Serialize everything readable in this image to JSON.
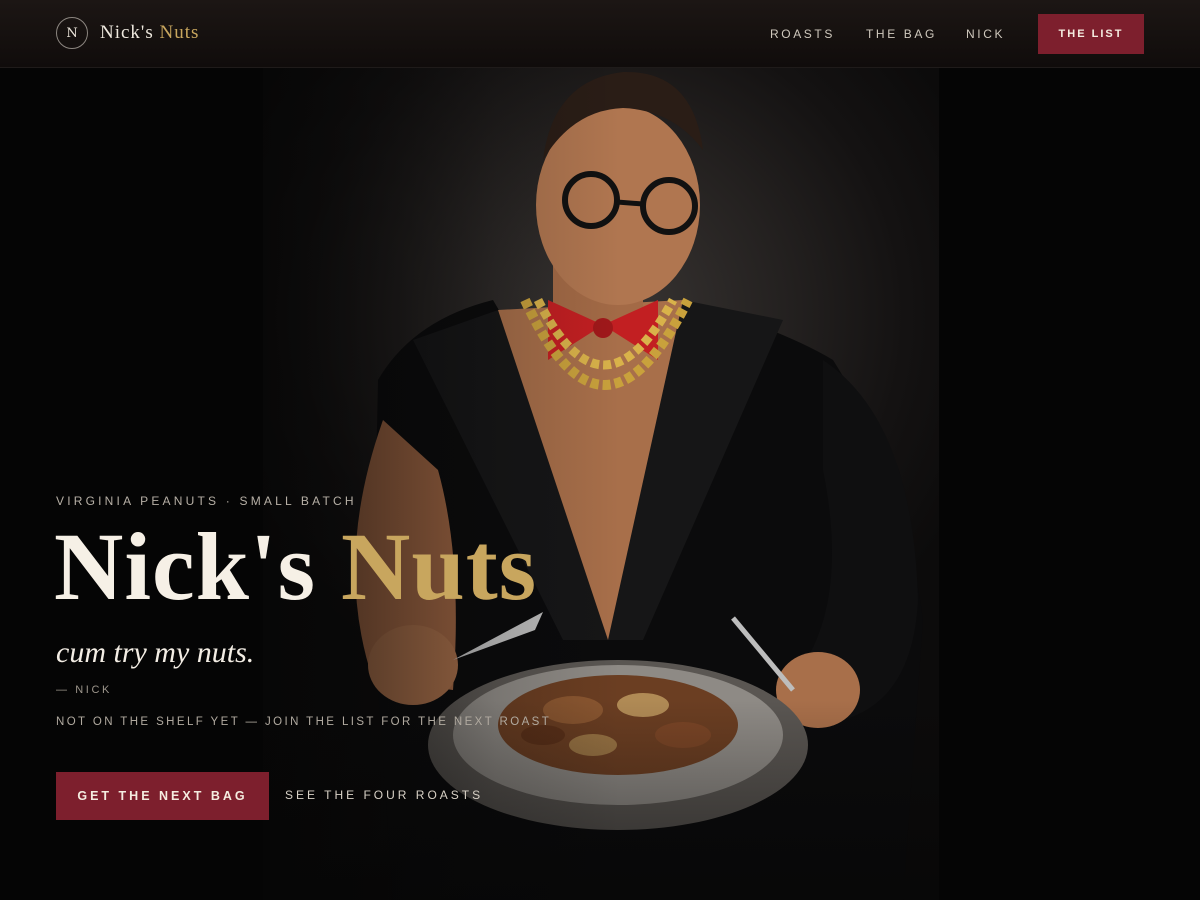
{
  "header": {
    "logo_mark": "N",
    "logo_name_part1": "Nick's",
    "logo_name_part2": "Nuts",
    "nav": {
      "roasts": "ROASTS",
      "the_bag": "THE BAG",
      "nick": "NICK"
    },
    "cta_label": "THE LIST"
  },
  "hero": {
    "eyebrow": "VIRGINIA PEANUTS · SMALL BATCH",
    "title_part1": "Nick's",
    "title_part2": "Nuts",
    "tagline": "cum try my nuts.",
    "attribution": "— NICK",
    "notice": "NOT ON THE SHELF YET — JOIN THE LIST FOR THE NEXT ROAST",
    "primary_button": "GET THE NEXT BAG",
    "secondary_link": "SEE THE FOUR ROASTS"
  },
  "colors": {
    "background": "#050505",
    "accent_burgundy": "#7d1f2d",
    "accent_gold": "#c8a65e",
    "text_cream": "#f6f0e6"
  }
}
